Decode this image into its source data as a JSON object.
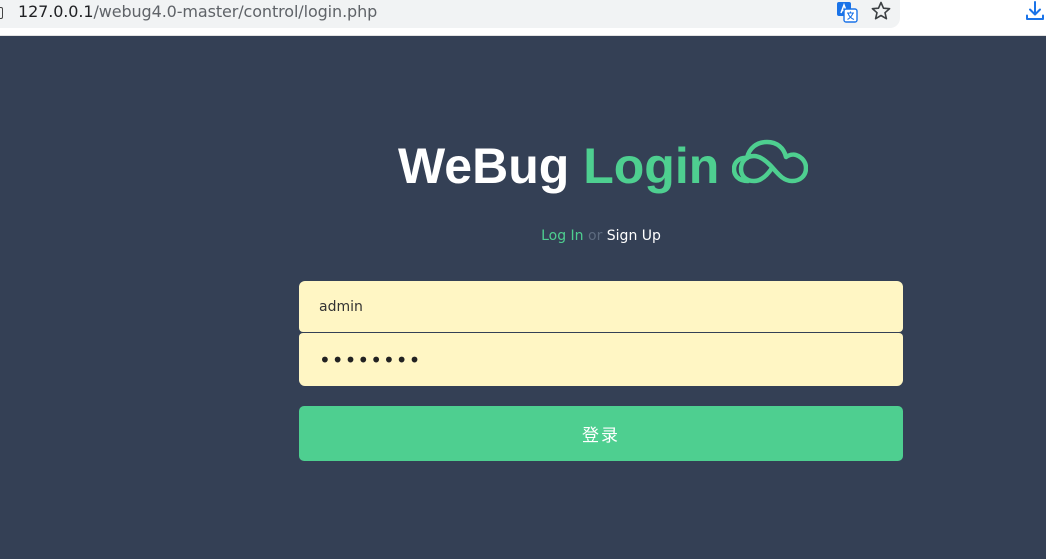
{
  "browser": {
    "url_host": "127.0.0.1",
    "url_path": "/webug4.0-master/control/login.php",
    "icons": [
      "site-info-icon",
      "translate-icon",
      "star-icon",
      "download-icon"
    ]
  },
  "page": {
    "title_part1": "WeBug",
    "title_part2": "Login",
    "title_icon": "cloud-icon",
    "tab_login": "Log In",
    "tab_separator": "or",
    "tab_signup": "Sign Up",
    "username_value": "admin",
    "password_value": "••••••••",
    "submit_label": "登录",
    "colors": {
      "background": "#344055",
      "accent": "#4ecf90",
      "input_bg": "#fff6c4"
    }
  }
}
